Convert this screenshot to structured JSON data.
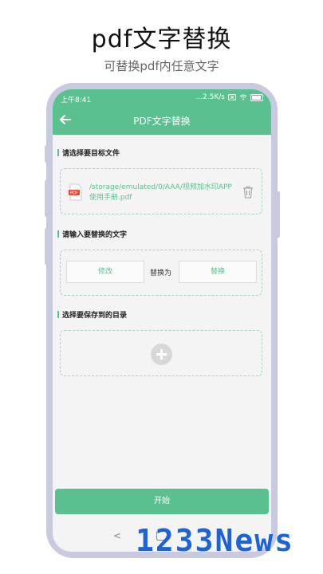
{
  "promo": {
    "title": "pdf文字替换",
    "subtitle": "可替换pdf内任意文字"
  },
  "status_bar": {
    "time": "上午8:41",
    "speed": "...2.5K/s",
    "battery_label": "78"
  },
  "app_bar": {
    "title": "PDF文字替换",
    "back_icon": "arrow-left-icon"
  },
  "sections": {
    "file": {
      "label": "请选择要目标文件",
      "file_path": "/storage/emulated/0/AAA/视频加水印APP 使用手册.pdf",
      "file_icon": "pdf-file-icon",
      "delete_icon": "trash-icon"
    },
    "replace": {
      "label": "请输入要替换的文字",
      "from_placeholder": "修改",
      "connector": "替换为",
      "to_placeholder": "替换"
    },
    "save_dir": {
      "label": "选择要保存到的目录",
      "add_icon": "plus-circle-icon"
    }
  },
  "start_button": "开始",
  "nav_bar": {
    "back_glyph": "<"
  },
  "watermark": "1233News",
  "colors": {
    "accent": "#5bc08f",
    "phone_frame": "#c9c9df",
    "screen_bg": "#f4f4f4",
    "watermark": "#1e63d6"
  }
}
